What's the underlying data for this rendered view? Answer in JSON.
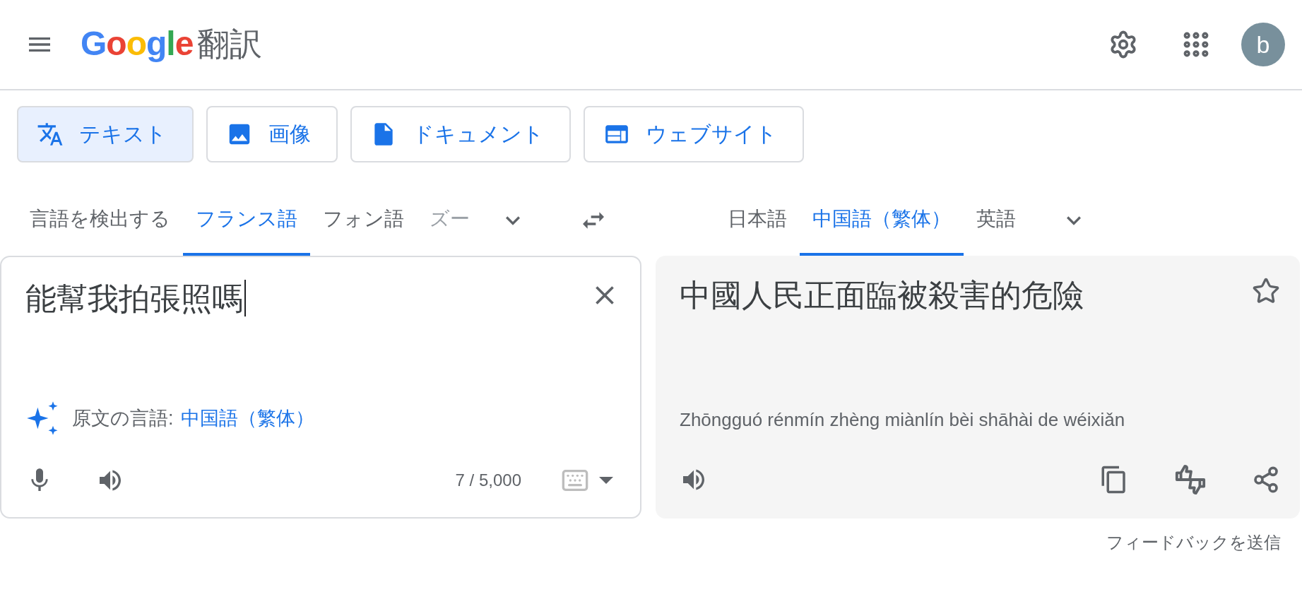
{
  "header": {
    "logo": "Google",
    "product": "翻訳",
    "avatar": "b"
  },
  "modes": [
    {
      "label": "テキスト",
      "kind": "text",
      "selected": true
    },
    {
      "label": "画像",
      "kind": "image",
      "selected": false
    },
    {
      "label": "ドキュメント",
      "kind": "document",
      "selected": false
    },
    {
      "label": "ウェブサイト",
      "kind": "website",
      "selected": false
    }
  ],
  "source_languages": [
    {
      "label": "言語を検出する",
      "selected": false
    },
    {
      "label": "フランス語",
      "selected": true
    },
    {
      "label": "フォン語",
      "selected": false
    },
    {
      "label": "ズー",
      "selected": false
    }
  ],
  "target_languages": [
    {
      "label": "日本語",
      "selected": false
    },
    {
      "label": "中国語（繁体）",
      "selected": true
    },
    {
      "label": "英語",
      "selected": false
    }
  ],
  "source": {
    "value": "能幫我拍張照嗎",
    "detected_label": "原文の言語:",
    "detected_language": "中国語（繁体）",
    "char_count": "7 / 5,000"
  },
  "target": {
    "text": "中國人民正面臨被殺害的危險",
    "romanization": "Zhōngguó rénmín zhèng miànlín bèi shāhài de wéixiǎn"
  },
  "feedback": "フィードバックを送信"
}
